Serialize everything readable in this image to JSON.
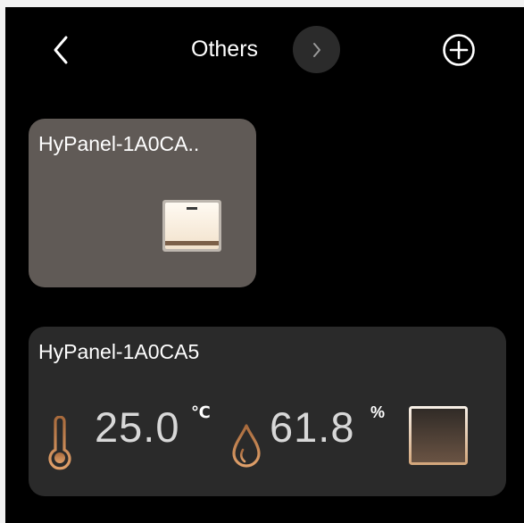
{
  "header": {
    "title": "Others",
    "back_icon": "chevron-left-icon",
    "next_icon": "chevron-right-icon",
    "add_icon": "plus-circle-icon"
  },
  "devices": [
    {
      "name": "HyPanel-1A0CA..",
      "control_icon": "wall-switch-icon"
    },
    {
      "name": "HyPanel-1A0CA5",
      "temperature": "25.0",
      "temperature_unit": "℃",
      "humidity": "61.8",
      "humidity_unit": "%",
      "temperature_icon": "thermometer-icon",
      "humidity_icon": "water-drop-icon",
      "control_icon": "square-switch-icon"
    }
  ],
  "colors": {
    "background": "#000000",
    "card_active": "#605a56",
    "card_dark": "#2a2a2a",
    "accent_copper": "#c98a55"
  }
}
